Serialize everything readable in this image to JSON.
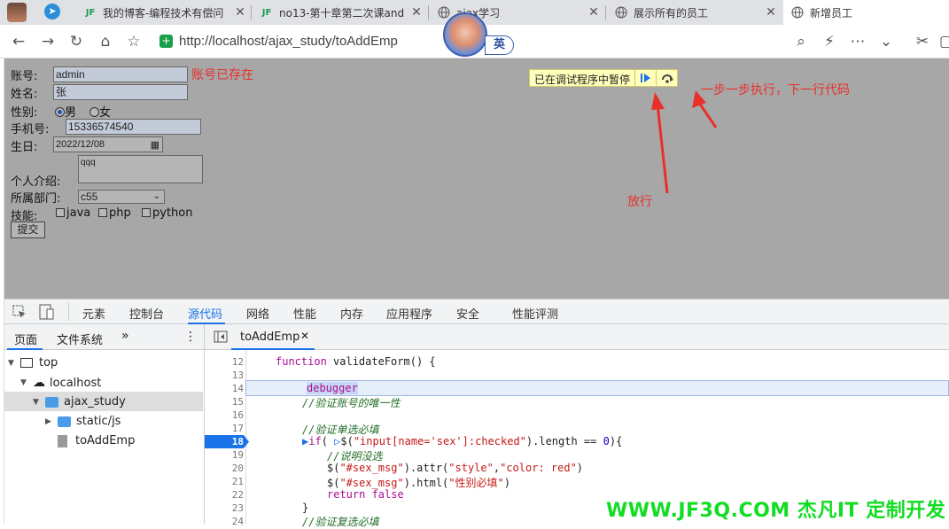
{
  "tabs": [
    {
      "title": "我的博客-编程技术有偿问",
      "icon": "jf3q-logo-icon"
    },
    {
      "title": "no13-第十章第二次课and",
      "icon": "jf3q-logo-icon"
    },
    {
      "title": "ajax学习",
      "icon": "globe-icon"
    },
    {
      "title": "展示所有的员工",
      "icon": "globe-icon"
    },
    {
      "title": "新增员工",
      "icon": "globe-icon",
      "active": true
    }
  ],
  "address": {
    "url": "http://localhost/ajax_study/toAddEmp",
    "ime": "英"
  },
  "form": {
    "account_label": "账号:",
    "account_value": "admin",
    "account_msg": "账号已存在",
    "name_label": "姓名:",
    "name_value": "张",
    "gender_label": "性别:",
    "male": "男",
    "female": "女",
    "phone_label": "手机号:",
    "phone_value": "15336574540",
    "birthday_label": "生日:",
    "birthday_value": "2022/12/08",
    "intro_label": "个人介绍:",
    "intro_value": "qqq",
    "dept_label": "所属部门:",
    "dept_value": "c55",
    "skills_label": "技能:",
    "skills": [
      "java",
      "php",
      "python"
    ],
    "submit": "提交"
  },
  "debug_overlay": {
    "paused_text": "已在调试程序中暂停"
  },
  "annotations": {
    "step": "一步一步执行，下一行代码",
    "resume": "放行",
    "color": "#e8302b"
  },
  "devtools": {
    "tabs": [
      "元素",
      "控制台",
      "源代码",
      "网络",
      "性能",
      "内存",
      "应用程序",
      "安全",
      "性能评测"
    ],
    "active_tab": "源代码",
    "nav_tabs": [
      "页面",
      "文件系统"
    ],
    "more": "»",
    "tree": [
      "top",
      "localhost",
      "ajax_study",
      "static/js",
      "toAddEmp"
    ],
    "file_tab": "toAddEmp",
    "line_numbers": [
      "12",
      "13",
      "14",
      "15",
      "16",
      "17",
      "18",
      "19",
      "20",
      "21",
      "22",
      "23",
      "24"
    ],
    "current_line": "18"
  },
  "watermark": "WWW.JF3Q.COM 杰凡IT 定制开发"
}
